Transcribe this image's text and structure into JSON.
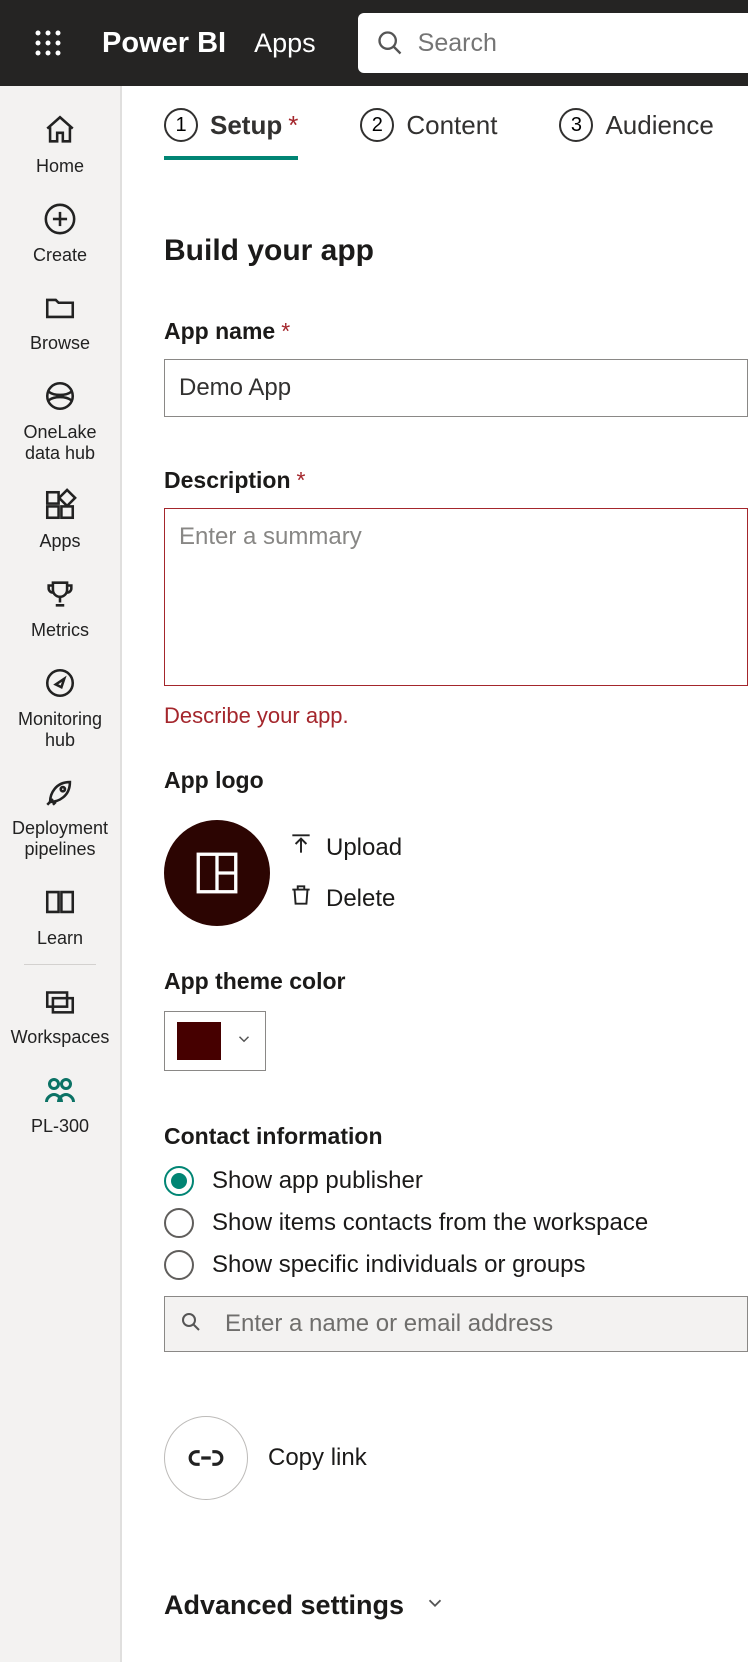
{
  "header": {
    "brand": "Power BI",
    "section": "Apps",
    "search_placeholder": "Search"
  },
  "nav": {
    "items": [
      {
        "label": "Home"
      },
      {
        "label": "Create"
      },
      {
        "label": "Browse"
      },
      {
        "label": "OneLake data hub"
      },
      {
        "label": "Apps"
      },
      {
        "label": "Metrics"
      },
      {
        "label": "Monitoring hub"
      },
      {
        "label": "Deployment pipelines"
      },
      {
        "label": "Learn"
      },
      {
        "label": "Workspaces"
      },
      {
        "label": "PL-300"
      }
    ]
  },
  "steps": [
    {
      "num": "1",
      "label": "Setup",
      "required": true,
      "active": true
    },
    {
      "num": "2",
      "label": "Content",
      "required": false,
      "active": false
    },
    {
      "num": "3",
      "label": "Audience",
      "required": false,
      "active": false
    }
  ],
  "page": {
    "title": "Build your app",
    "app_name_label": "App name",
    "app_name_value": "Demo App",
    "description_label": "Description",
    "description_placeholder": "Enter a summary",
    "description_error": "Describe your app.",
    "app_logo_label": "App logo",
    "upload_label": "Upload",
    "delete_label": "Delete",
    "theme_label": "App theme color",
    "theme_color": "#460000",
    "contact_label": "Contact information",
    "contact_options": [
      "Show app publisher",
      "Show items contacts from the workspace",
      "Show specific individuals or groups"
    ],
    "contact_selected_index": 0,
    "contact_lookup_placeholder": "Enter a name or email address",
    "copy_link_label": "Copy link",
    "advanced_label": "Advanced settings"
  }
}
